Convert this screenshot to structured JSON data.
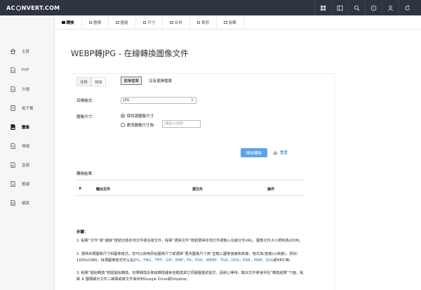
{
  "brand": {
    "prefix": "AC",
    "suffix": "NVERT.COM"
  },
  "top_icons": [
    "grid-icon",
    "panel-icon",
    "search-icon",
    "help-icon",
    "user-icon",
    "refresh-icon"
  ],
  "tabs": [
    {
      "label": "轉換",
      "active": true
    },
    {
      "label": "圖標",
      "active": false
    },
    {
      "label": "壓縮",
      "active": false
    },
    {
      "label": "尺寸",
      "active": false
    },
    {
      "label": "合併",
      "active": false
    },
    {
      "label": "裁剪",
      "active": false
    },
    {
      "label": "旋轉",
      "active": false
    }
  ],
  "sidebar": [
    {
      "label": "主頁",
      "icon": "home-icon"
    },
    {
      "label": "PDF",
      "icon": "pdf-icon"
    },
    {
      "label": "文檔",
      "icon": "document-icon"
    },
    {
      "label": "電子書",
      "icon": "ebook-icon"
    },
    {
      "label": "圖像",
      "icon": "image-icon",
      "active": true
    },
    {
      "label": "視頻",
      "icon": "video-icon"
    },
    {
      "label": "音頻",
      "icon": "audio-icon"
    },
    {
      "label": "壓縮",
      "icon": "archive-icon"
    },
    {
      "label": "網頁",
      "icon": "web-icon"
    }
  ],
  "main": {
    "title": "WEBP轉JPG - 在線轉換圖像文件",
    "mode_file": "文件",
    "mode_link": "鏈接",
    "choose_file": "選擇檔案",
    "no_file": "沒有選擇檔案",
    "target_format_label": "目標格式：",
    "target_format_value": "JPG",
    "image_size_label": "圖像尺寸：",
    "keep_size": "保持源圖像尺寸",
    "change_size": "更改圖像尺寸為：",
    "size_placeholder": "(寬度)x(高度)",
    "convert_button": "開始轉換",
    "reset_label": "重置",
    "results_title": "轉換結果：",
    "col_index": "#",
    "col_output": "輸出文件",
    "col_source": "源文件",
    "col_action": "操作",
    "steps_title": "步驟：",
    "step1": "1. 點擊“文件”或“鏈接”按鈕切換本地文件或在線文件，點擊“選擇文件”按鈕選擇本地文件或輸入在線文件URL，圖像文件大小限制為200M。",
    "step2a": "2. 選擇目標圖像尺寸和圖像格式。您可以使用原始圖像尺寸或選擇“更改圖像尺寸為”並輸入圖像寬度和高度，格式為(寬度)x(高度)，例如：1920x1080。目標圖像格式可以是",
    "step2_formats": "JPG，PNG，TIFF，GIF，BMP，PS，PSD，WEBP，TGA，DDS，EXR，PNM，SVG",
    "step2b": "或HEIC等。",
    "step3": "3. 點擊“開始轉換”按鈕開始轉換。如果轉換失敗該轉換器會自動換其它伺服器重試提交，請耐心等待，輸出文件將會列在“轉換結果”下面，點擊 ⬇ 圖標顯示文件二維碼或將文件保存到Google Drive或Dropbox。"
  }
}
